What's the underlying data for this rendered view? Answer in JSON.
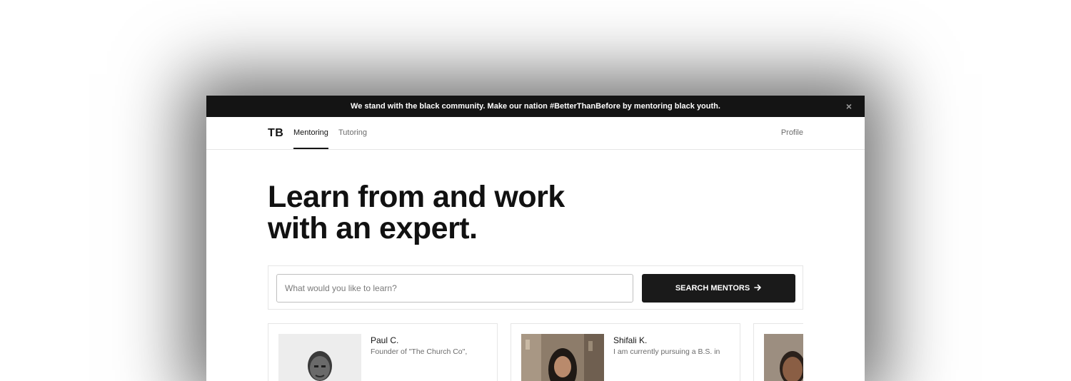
{
  "banner": {
    "message": "We stand with the black community. Make our nation #BetterThanBefore by mentoring black youth.",
    "close_icon": "×"
  },
  "nav": {
    "logo": "TB",
    "tabs": [
      {
        "label": "Mentoring",
        "active": true
      },
      {
        "label": "Tutoring",
        "active": false
      }
    ],
    "profile": "Profile"
  },
  "hero": {
    "title_line1": "Learn from and work",
    "title_line2": "with an expert."
  },
  "search": {
    "placeholder": "What would you like to learn?",
    "value": "",
    "button_label": "SEARCH MENTORS",
    "button_icon": "→"
  },
  "mentors": [
    {
      "name": "Paul C.",
      "description": "Founder of \"The Church Co\","
    },
    {
      "name": "Shifali K.",
      "description": "I am currently pursuing a B.S. in"
    },
    {
      "name": "",
      "description": ""
    }
  ],
  "colors": {
    "banner_bg": "#141414",
    "button_bg": "#1a1a1a",
    "text_primary": "#141414",
    "text_muted": "#6b6b6b",
    "border": "#e6e6e6"
  }
}
